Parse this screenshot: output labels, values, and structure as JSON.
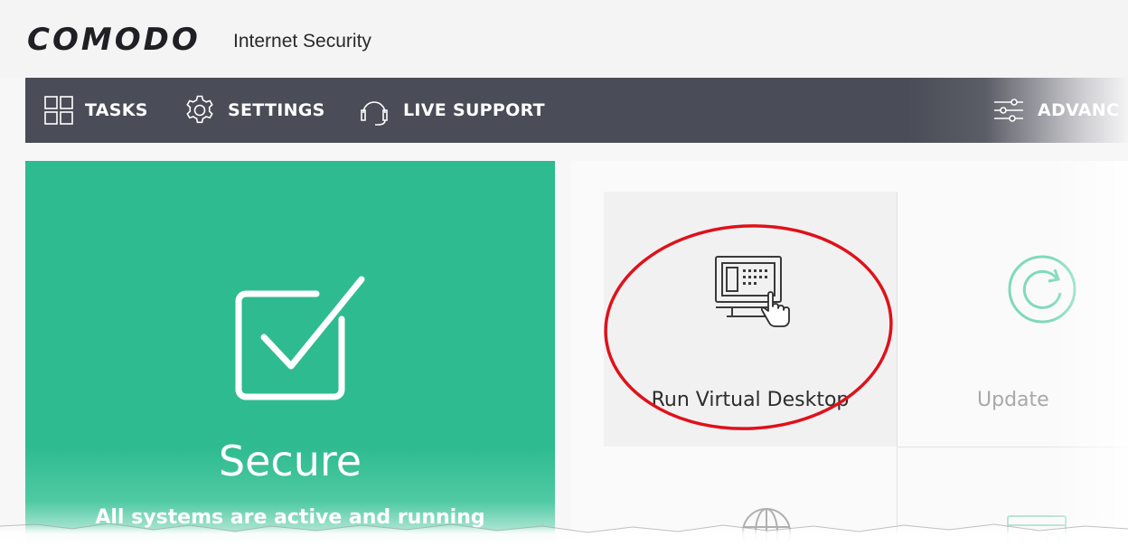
{
  "titlebar": {
    "brand": "COMODO",
    "product": "Internet Security"
  },
  "toolbar": {
    "items": [
      {
        "label": "TASKS",
        "icon": "grid-icon"
      },
      {
        "label": "SETTINGS",
        "icon": "gear-icon"
      },
      {
        "label": "LIVE SUPPORT",
        "icon": "headset-icon"
      }
    ],
    "advanced_label": "ADVANC",
    "advanced_icon": "sliders-icon",
    "colors": {
      "bar": "#4a4c57",
      "text": "#ffffff"
    }
  },
  "status": {
    "title": "Secure",
    "subtitle": "All systems are active and running",
    "icon": "checkbox-icon",
    "color": "#2ebb8f"
  },
  "tasks": {
    "virtual_desktop": {
      "label": "Run Virtual Desktop",
      "icon": "virtual-desktop-icon"
    },
    "update": {
      "label": "Update",
      "icon": "update-icon",
      "accent": "#33c49a"
    },
    "bottom_left_icon": "globe-icon",
    "bottom_right_icon": "browser-window-icon"
  },
  "annotation": {
    "color": "#e0111a"
  }
}
